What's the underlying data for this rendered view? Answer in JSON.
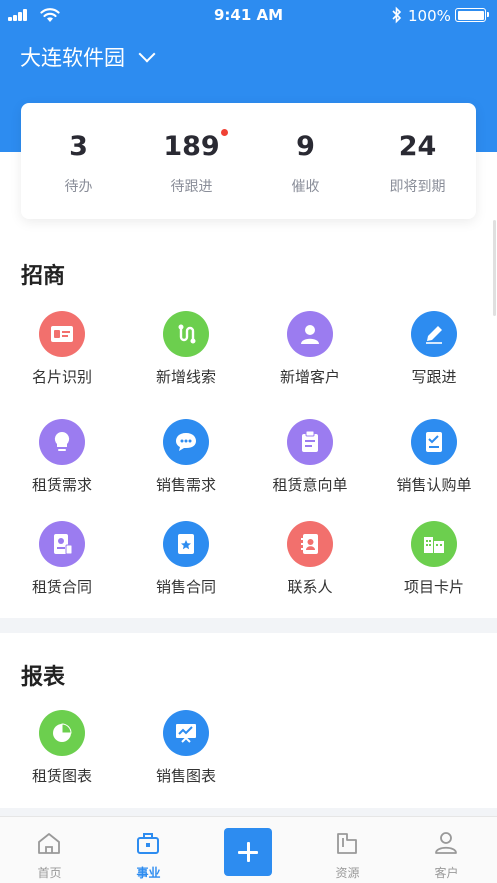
{
  "status_bar": {
    "time": "9:41 AM",
    "battery": "100%"
  },
  "header": {
    "location": "大连软件园"
  },
  "stats": [
    {
      "value": "3",
      "label": "待办",
      "has_badge": false
    },
    {
      "value": "189",
      "label": "待跟进",
      "has_badge": true
    },
    {
      "value": "9",
      "label": "催收",
      "has_badge": false
    },
    {
      "value": "24",
      "label": "即将到期",
      "has_badge": false
    }
  ],
  "sections": {
    "investment": {
      "title": "招商",
      "items": [
        {
          "label": "名片识别",
          "icon": "id-card-icon",
          "color": "#f2706d"
        },
        {
          "label": "新增线索",
          "icon": "route-icon",
          "color": "#6ccf4e"
        },
        {
          "label": "新增客户",
          "icon": "add-customer-icon",
          "color": "#9b7cf0"
        },
        {
          "label": "写跟进",
          "icon": "pencil-icon",
          "color": "#2d8cf0"
        },
        {
          "label": "租赁需求",
          "icon": "lightbulb-icon",
          "color": "#9b7cf0"
        },
        {
          "label": "销售需求",
          "icon": "chat-bubble-icon",
          "color": "#2d8cf0"
        },
        {
          "label": "租赁意向单",
          "icon": "clipboard-icon",
          "color": "#9b7cf0"
        },
        {
          "label": "销售认购单",
          "icon": "checklist-icon",
          "color": "#2d8cf0"
        },
        {
          "label": "租赁合同",
          "icon": "contract-icon",
          "color": "#9b7cf0"
        },
        {
          "label": "销售合同",
          "icon": "star-document-icon",
          "color": "#2d8cf0"
        },
        {
          "label": "联系人",
          "icon": "contact-book-icon",
          "color": "#f2706d"
        },
        {
          "label": "项目卡片",
          "icon": "building-icon",
          "color": "#6ccf4e"
        }
      ]
    },
    "reports": {
      "title": "报表",
      "items": [
        {
          "label": "租赁图表",
          "icon": "pie-chart-icon",
          "color": "#6ccf4e"
        },
        {
          "label": "销售图表",
          "icon": "presentation-chart-icon",
          "color": "#2d8cf0"
        }
      ]
    }
  },
  "tabbar": {
    "tabs": [
      {
        "label": "首页",
        "icon": "home-icon",
        "active": false
      },
      {
        "label": "事业",
        "icon": "briefcase-icon",
        "active": true
      },
      {
        "label": "资源",
        "icon": "resource-icon",
        "active": false
      },
      {
        "label": "客户",
        "icon": "person-icon",
        "active": false
      }
    ]
  },
  "colors": {
    "primary": "#2d8cf0",
    "badge": "#f04134"
  }
}
